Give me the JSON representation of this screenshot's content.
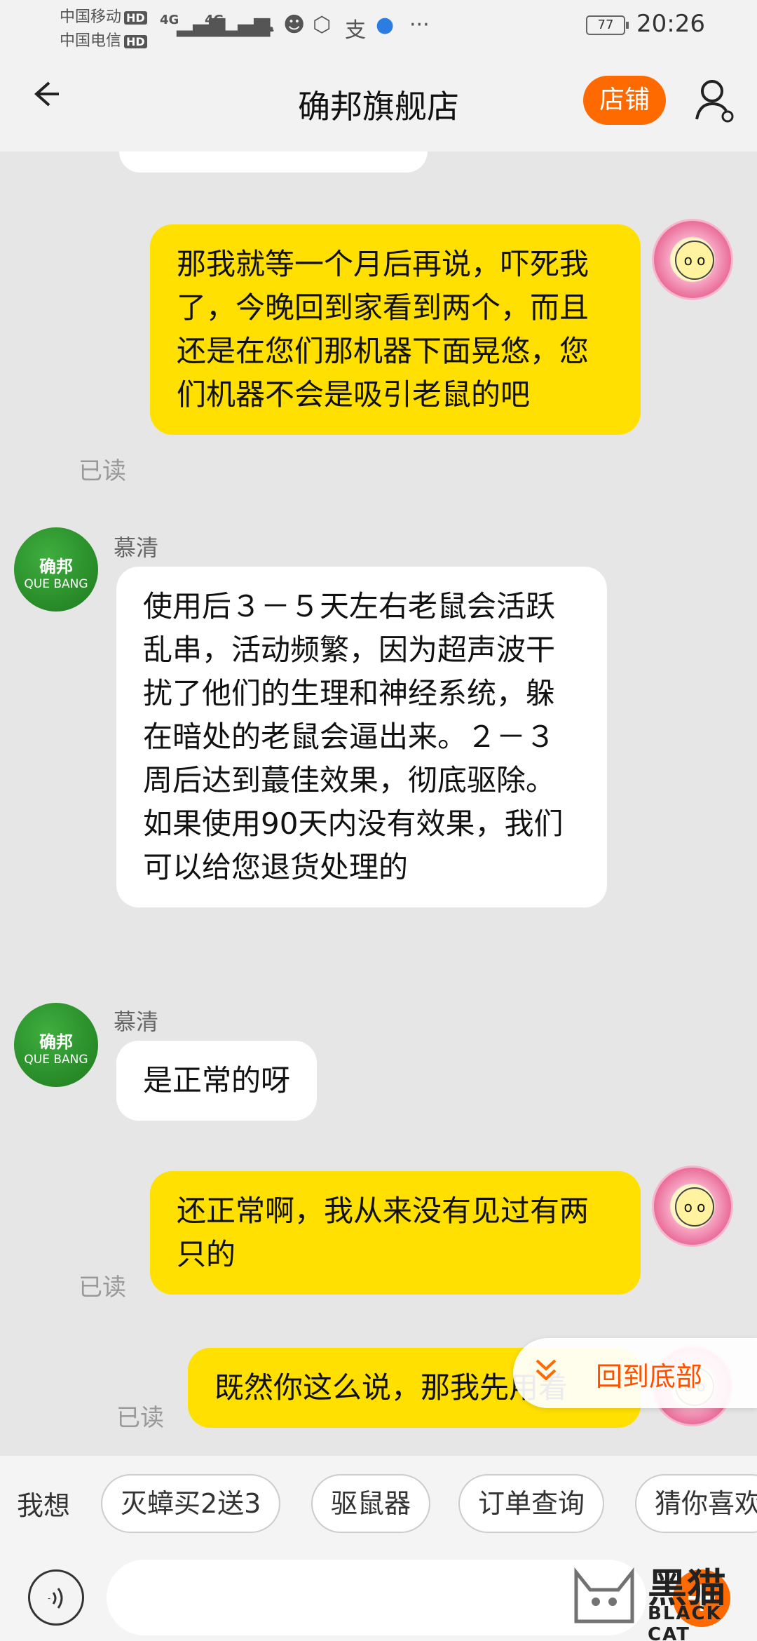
{
  "status_bar": {
    "carrier1": "中国移动",
    "carrier2": "中国电信",
    "hd_badge": "HD",
    "network1": "4G",
    "network2": "4G",
    "battery": "77",
    "time": "20:26",
    "more": "···"
  },
  "header": {
    "title": "确邦旗舰店",
    "shop_button": "店铺"
  },
  "shop_avatar": {
    "line1": "确邦",
    "line2": "QUE BANG"
  },
  "messages": [
    {
      "sender": "me",
      "text": "那我就等一个月后再说，吓死我了，今晚回到家看到两个，而且还是在您们那机器下面晃悠，您们机器不会是吸引老鼠的吧",
      "status": "已读"
    },
    {
      "sender": "them",
      "name": "慕清",
      "text": "使用后３－５天左右老鼠会活跃乱串，活动频繁，因为超声波干扰了他们的生理和神经系统，躲在暗处的老鼠会逼出来。２－３周后达到蕞佳效果，彻底驱除。如果使用90天内没有效果，我们可以给您退货处理的"
    },
    {
      "sender": "them",
      "name": "慕清",
      "text": "是正常的呀"
    },
    {
      "sender": "me",
      "text": "还正常啊，我从来没有见过有两只的",
      "status": "已读"
    },
    {
      "sender": "me",
      "text": "既然你这么说，那我先用着",
      "status": "已读"
    }
  ],
  "float_button": {
    "label": "回到底部"
  },
  "quick_bar": {
    "label": "我想",
    "chips": [
      "灭蟑买2送3",
      "驱鼠器",
      "订单查询",
      "猜你喜欢"
    ]
  },
  "input": {
    "placeholder": ""
  },
  "watermark": {
    "brand_cn": "黑猫",
    "brand_en": "BLACK CAT"
  },
  "colors": {
    "accent": "#ff6a00",
    "my_bubble": "#ffe000",
    "their_bubble": "#ffffff",
    "background": "#e6e6e6"
  }
}
